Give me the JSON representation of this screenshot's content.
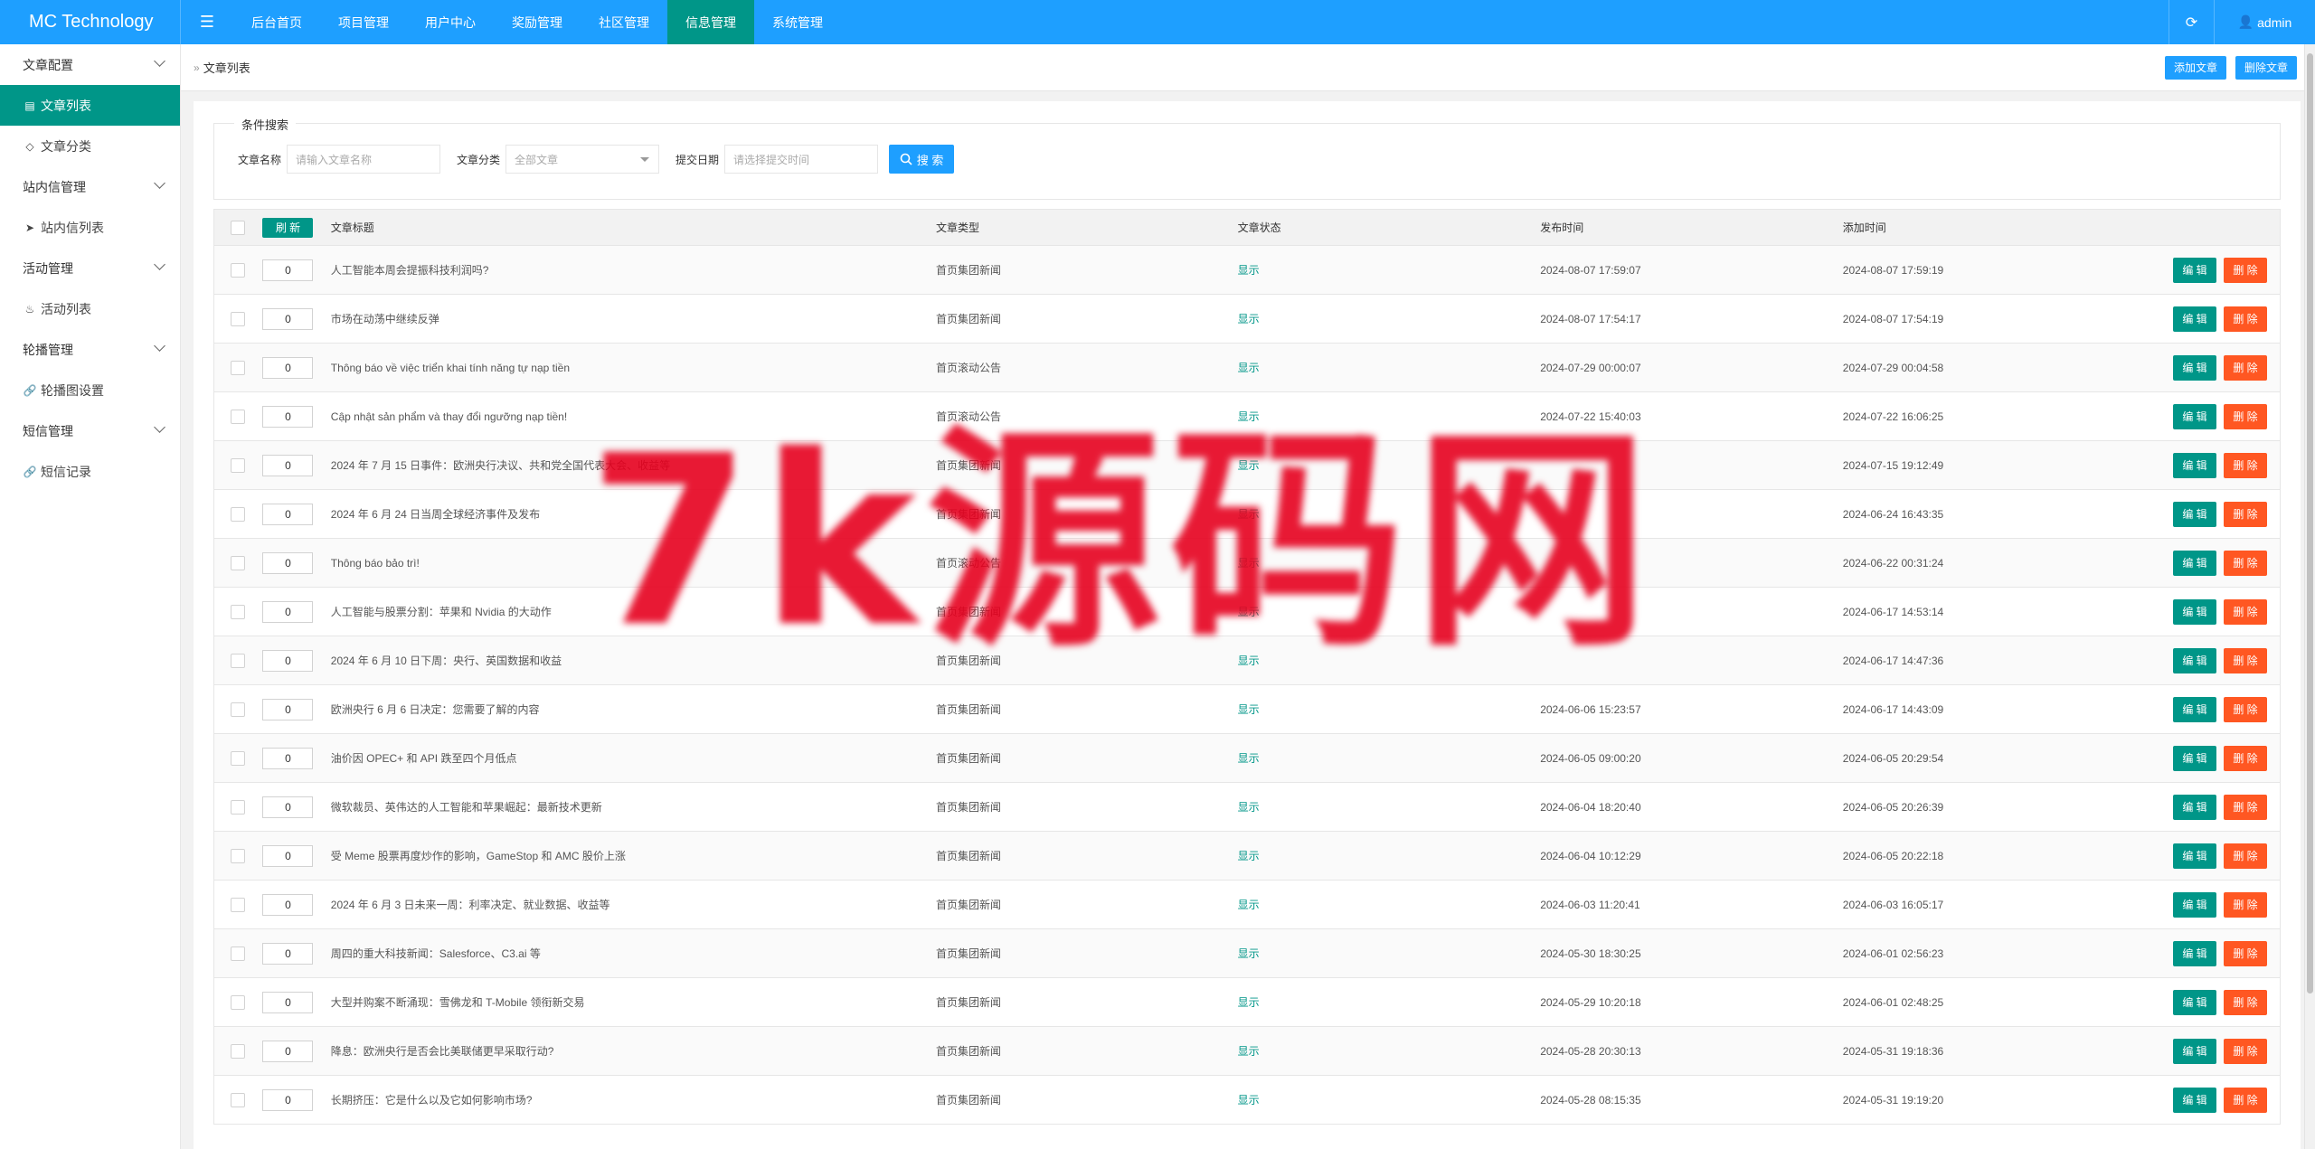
{
  "header": {
    "brand": "MC Technology",
    "menu_toggle_icon": "hamburger-icon",
    "nav": [
      {
        "label": "后台首页",
        "active": false
      },
      {
        "label": "项目管理",
        "active": false
      },
      {
        "label": "用户中心",
        "active": false
      },
      {
        "label": "奖励管理",
        "active": false
      },
      {
        "label": "社区管理",
        "active": false
      },
      {
        "label": "信息管理",
        "active": true
      },
      {
        "label": "系统管理",
        "active": false
      }
    ],
    "refresh_icon": "refresh-icon",
    "user": "admin"
  },
  "sidebar": {
    "items": [
      {
        "label": "文章配置",
        "type": "group"
      },
      {
        "label": "文章列表",
        "type": "sub",
        "active": true
      },
      {
        "label": "文章分类",
        "type": "sub"
      },
      {
        "label": "站内信管理",
        "type": "group"
      },
      {
        "label": "站内信列表",
        "type": "sub"
      },
      {
        "label": "活动管理",
        "type": "group"
      },
      {
        "label": "活动列表",
        "type": "sub"
      },
      {
        "label": "轮播管理",
        "type": "group"
      },
      {
        "label": "轮播图设置",
        "type": "sub"
      },
      {
        "label": "短信管理",
        "type": "group"
      },
      {
        "label": "短信记录",
        "type": "sub"
      }
    ]
  },
  "breadcrumb": {
    "current": "文章列表",
    "add_button": "添加文章",
    "delete_button": "删除文章"
  },
  "search": {
    "legend": "条件搜索",
    "name_label": "文章名称",
    "name_placeholder": "请输入文章名称",
    "category_label": "文章分类",
    "category_value": "全部文章",
    "date_label": "提交日期",
    "date_placeholder": "请选择提交时间",
    "search_button": "搜 索"
  },
  "table": {
    "refresh_button": "刷 新",
    "headers": {
      "title": "文章标题",
      "type": "文章类型",
      "status": "文章状态",
      "published": "发布时间",
      "added": "添加时间"
    },
    "edit_label": "编 辑",
    "delete_label": "删 除",
    "rows": [
      {
        "sort": "0",
        "title": "人工智能本周会提振科技利润吗?",
        "type": "首页集团新闻",
        "status": "显示",
        "published": "2024-08-07 17:59:07",
        "added": "2024-08-07 17:59:19"
      },
      {
        "sort": "0",
        "title": "市场在动荡中继续反弹",
        "type": "首页集团新闻",
        "status": "显示",
        "published": "2024-08-07 17:54:17",
        "added": "2024-08-07 17:54:19"
      },
      {
        "sort": "0",
        "title": "Thông báo về việc triển khai tính năng tự nạp tiền",
        "type": "首页滚动公告",
        "status": "显示",
        "published": "2024-07-29 00:00:07",
        "added": "2024-07-29 00:04:58"
      },
      {
        "sort": "0",
        "title": "Cập nhật sản phẩm và thay đổi ngưỡng nạp tiền!",
        "type": "首页滚动公告",
        "status": "显示",
        "published": "2024-07-22 15:40:03",
        "added": "2024-07-22 16:06:25"
      },
      {
        "sort": "0",
        "title": "2024 年 7 月 15 日事件：欧洲央行决议、共和党全国代表大会、收益等",
        "type": "首页集团新闻",
        "status": "显示",
        "published": "",
        "added": "2024-07-15 19:12:49"
      },
      {
        "sort": "0",
        "title": "2024 年 6 月 24 日当周全球经济事件及发布",
        "type": "首页集团新闻",
        "status": "显示",
        "published": "",
        "added": "2024-06-24 16:43:35"
      },
      {
        "sort": "0",
        "title": "Thông báo bảo trì!",
        "type": "首页滚动公告",
        "status": "显示",
        "published": "",
        "added": "2024-06-22 00:31:24"
      },
      {
        "sort": "0",
        "title": "人工智能与股票分割：苹果和 Nvidia 的大动作",
        "type": "首页集团新闻",
        "status": "显示",
        "published": "",
        "added": "2024-06-17 14:53:14"
      },
      {
        "sort": "0",
        "title": "2024 年 6 月 10 日下周：央行、英国数据和收益",
        "type": "首页集团新闻",
        "status": "显示",
        "published": "",
        "added": "2024-06-17 14:47:36"
      },
      {
        "sort": "0",
        "title": "欧洲央行 6 月 6 日决定：您需要了解的内容",
        "type": "首页集团新闻",
        "status": "显示",
        "published": "2024-06-06 15:23:57",
        "added": "2024-06-17 14:43:09"
      },
      {
        "sort": "0",
        "title": "油价因 OPEC+ 和 API 跌至四个月低点",
        "type": "首页集团新闻",
        "status": "显示",
        "published": "2024-06-05 09:00:20",
        "added": "2024-06-05 20:29:54"
      },
      {
        "sort": "0",
        "title": "微软裁员、英伟达的人工智能和苹果崛起：最新技术更新",
        "type": "首页集团新闻",
        "status": "显示",
        "published": "2024-06-04 18:20:40",
        "added": "2024-06-05 20:26:39"
      },
      {
        "sort": "0",
        "title": "受 Meme 股票再度炒作的影响，GameStop 和 AMC 股价上涨",
        "type": "首页集团新闻",
        "status": "显示",
        "published": "2024-06-04 10:12:29",
        "added": "2024-06-05 20:22:18"
      },
      {
        "sort": "0",
        "title": "2024 年 6 月 3 日未来一周：利率决定、就业数据、收益等",
        "type": "首页集团新闻",
        "status": "显示",
        "published": "2024-06-03 11:20:41",
        "added": "2024-06-03 16:05:17"
      },
      {
        "sort": "0",
        "title": "周四的重大科技新闻：Salesforce、C3.ai 等",
        "type": "首页集团新闻",
        "status": "显示",
        "published": "2024-05-30 18:30:25",
        "added": "2024-06-01 02:56:23"
      },
      {
        "sort": "0",
        "title": "大型并购案不断涌现：雪佛龙和 T-Mobile 领衔新交易",
        "type": "首页集团新闻",
        "status": "显示",
        "published": "2024-05-29 10:20:18",
        "added": "2024-06-01 02:48:25"
      },
      {
        "sort": "0",
        "title": "降息：欧洲央行是否会比美联储更早采取行动?",
        "type": "首页集团新闻",
        "status": "显示",
        "published": "2024-05-28 20:30:13",
        "added": "2024-05-31 19:18:36"
      },
      {
        "sort": "0",
        "title": "长期挤压：它是什么以及它如何影响市场?",
        "type": "首页集团新闻",
        "status": "显示",
        "published": "2024-05-28 08:15:35",
        "added": "2024-05-31 19:19:20"
      }
    ]
  },
  "watermark": "7k源码网",
  "colors": {
    "topbar": "#1e9fff",
    "active": "#009688",
    "danger": "#ff5722",
    "watermark": "#e6001e"
  }
}
